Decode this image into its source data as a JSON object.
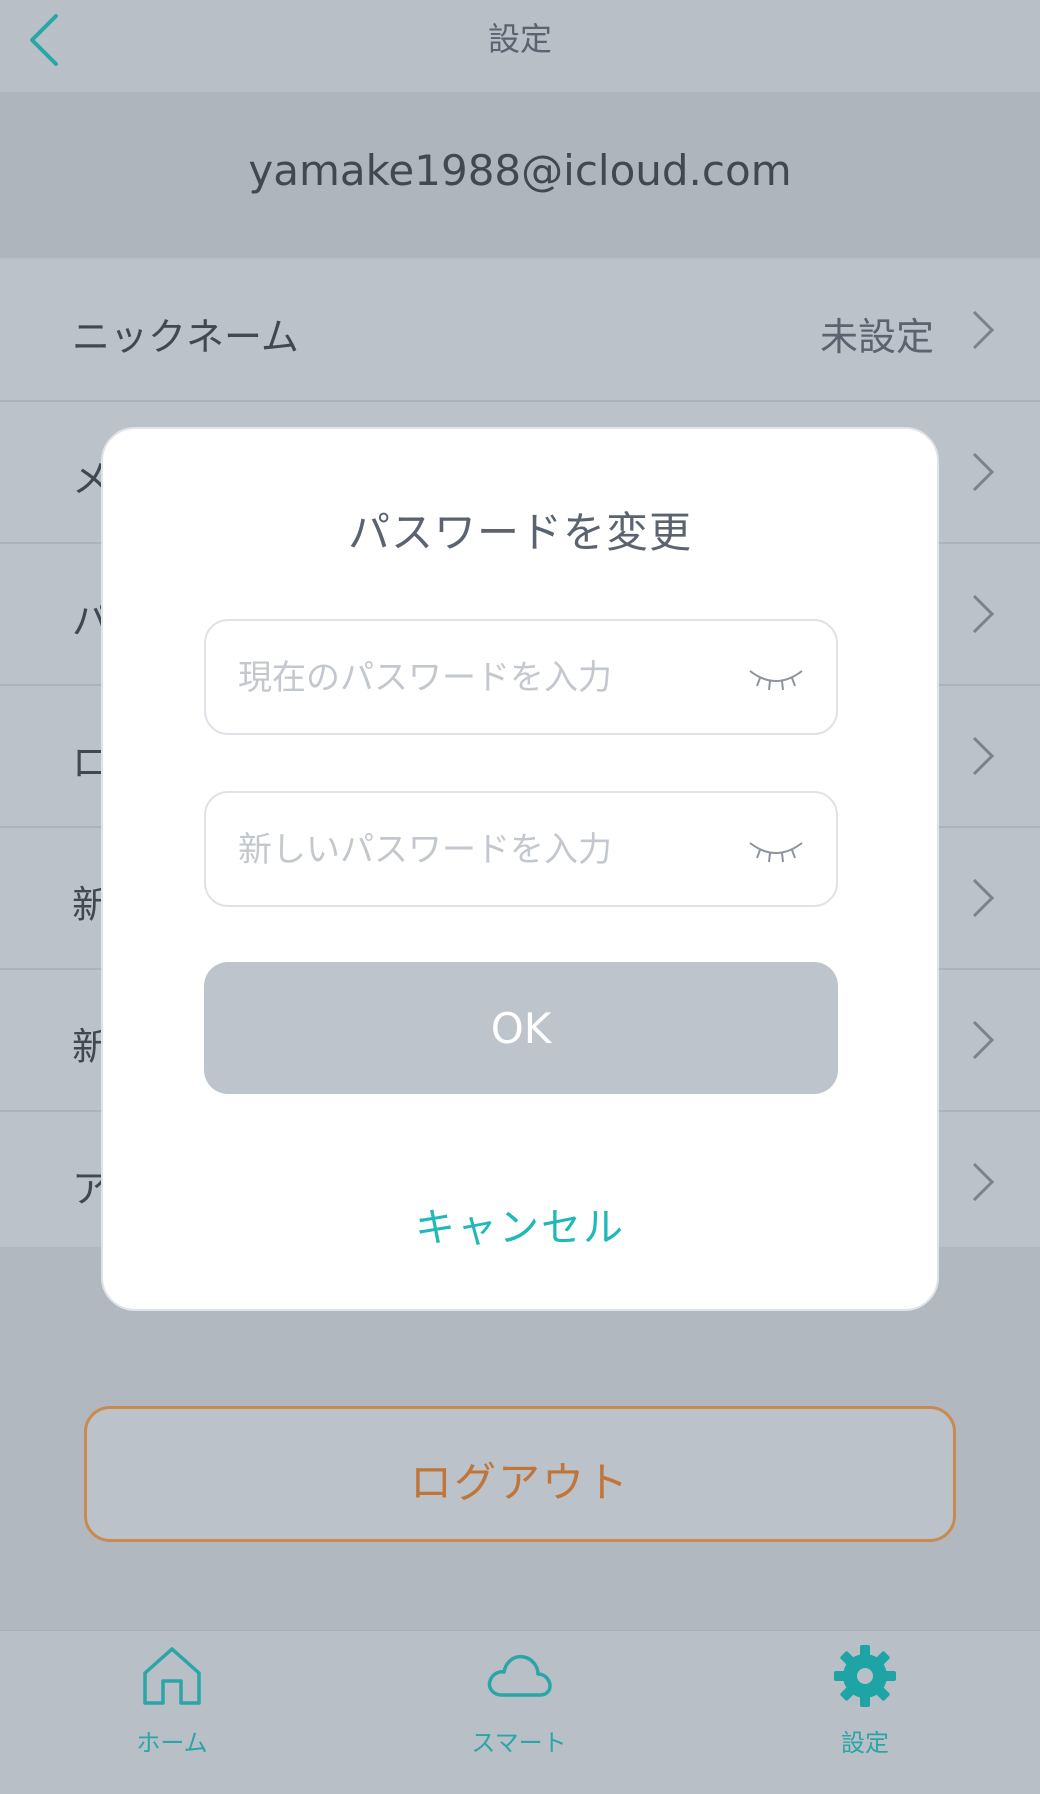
{
  "header": {
    "title": "設定"
  },
  "account": {
    "email": "yamake1988@icloud.com"
  },
  "settings": {
    "rows": [
      {
        "label": "ニックネーム",
        "value": "未設定"
      },
      {
        "label": "メ",
        "value": ""
      },
      {
        "label": "パ",
        "value": ""
      },
      {
        "label": "ロ",
        "value": ""
      },
      {
        "label": "新",
        "value": ""
      },
      {
        "label": "新",
        "value": ""
      },
      {
        "label": "ア",
        "value": ""
      }
    ]
  },
  "logout": {
    "label": "ログアウト"
  },
  "dialog": {
    "title": "パスワードを変更",
    "current_password_placeholder": "現在のパスワードを入力",
    "new_password_placeholder": "新しいパスワードを入力",
    "ok_label": "OK",
    "cancel_label": "キャンセル"
  },
  "tabbar": {
    "tabs": [
      {
        "label": "ホーム",
        "icon": "home-icon"
      },
      {
        "label": "スマート",
        "icon": "cloud-icon"
      },
      {
        "label": "設定",
        "icon": "gear-icon"
      }
    ]
  },
  "colors": {
    "accent": "#21b8b8",
    "logout": "#c0763a",
    "ok_button": "#bec4cc"
  }
}
